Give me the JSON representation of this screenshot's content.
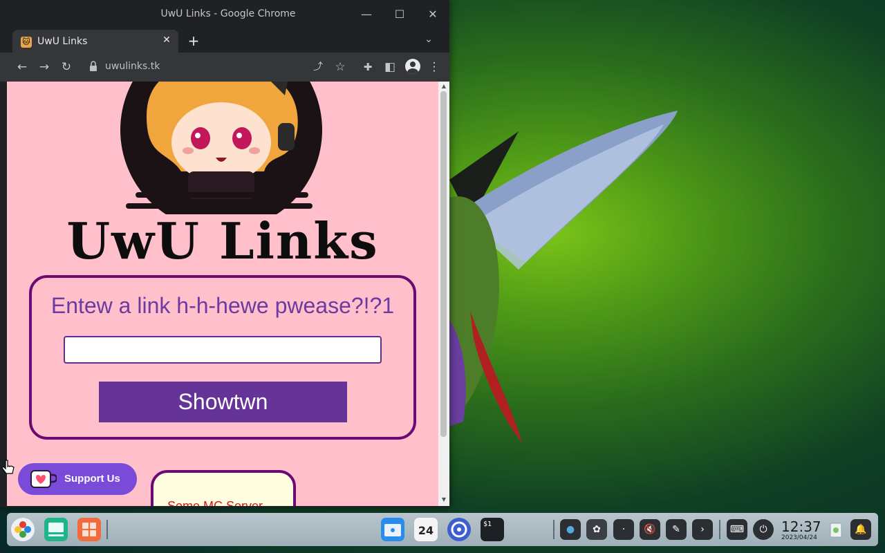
{
  "window": {
    "title": "UwU Links - Google Chrome",
    "minimize_icon": "—",
    "maximize_icon": "☐",
    "close_icon": "✕"
  },
  "tab": {
    "title": "UwU Links",
    "favicon": "🐱",
    "close_icon": "✕",
    "new_tab_icon": "+",
    "tab_search_icon": "⌄"
  },
  "toolbar": {
    "back_icon": "←",
    "forward_icon": "→",
    "reload_icon": "↻",
    "url": "uwulinks.tk",
    "share_icon": "⤴",
    "star_icon": "☆",
    "extensions_icon": "✚",
    "sidepanel_icon": "◧",
    "menu_icon": "⋮"
  },
  "page": {
    "brand": "UwU Links",
    "prompt": "Entew a link h-h-hewe pwease?!?1",
    "input_value": "",
    "input_placeholder": "",
    "shorten_label": "Showtwn",
    "support_label": "Support Us",
    "mc_label": "Some MC Server"
  },
  "scrollbar": {
    "up_icon": "▲",
    "down_icon": "▼"
  },
  "taskbar": {
    "calendar_day": "24",
    "terminal_glyph": "$1",
    "time": "12:37",
    "date": "2023/04/24",
    "mute_icon": "🔇",
    "keyboard_icon": "⌨",
    "power_icon": "⏻",
    "expand_icon": "›",
    "bell_icon": "🔔"
  },
  "colors": {
    "page_bg": "#ffc0cb",
    "card_border": "#6a0a72",
    "button": "#663399",
    "prompt_text": "#6c3aa0",
    "support": "#7a4bd9"
  }
}
